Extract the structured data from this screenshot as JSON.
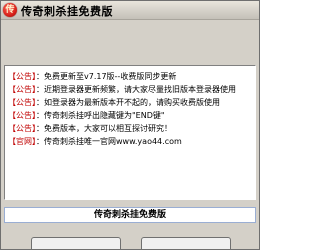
{
  "window": {
    "title": "传奇刺杀挂免费版",
    "icon_glyph": "传",
    "icon_name": "app-icon"
  },
  "log": {
    "lines": [
      {
        "tag": "【公告】",
        "text": "：免费更新至v7.17版--收费版同步更新"
      },
      {
        "tag": "【公告】",
        "text": "：近期登录器更新频繁，请大家尽量找旧版本登录器使用"
      },
      {
        "tag": "【公告】",
        "text": "：如登录器为最新版本开不起的，请购买收费版使用"
      },
      {
        "tag": "【公告】",
        "text": "：传奇刺杀挂呼出隐藏键为\"END键\""
      },
      {
        "tag": "【公告】",
        "text": "：免费版本，大家可以相互探讨研究！"
      },
      {
        "tag": "【官网】",
        "text": "：传奇刺杀挂唯一官网www.yao44.com"
      }
    ]
  },
  "banner": {
    "text": "传奇刺杀挂免费版"
  },
  "buttons": {
    "left_label": "",
    "right_label": ""
  },
  "colors": {
    "tag_red": "#c00000",
    "window_gray": "#d4d0c8",
    "banner_border": "#9aaed3"
  }
}
